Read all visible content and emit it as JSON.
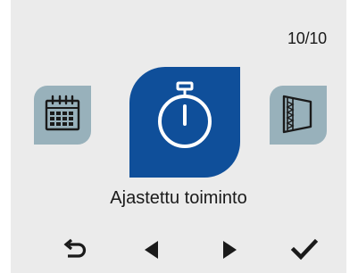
{
  "header": {
    "page_counter": "10/10"
  },
  "carousel": {
    "items": [
      {
        "icon": "calendar-icon",
        "selected": false
      },
      {
        "icon": "stopwatch-icon",
        "selected": true
      },
      {
        "icon": "filter-icon",
        "selected": false
      }
    ],
    "selected_label": "Ajastettu toiminto"
  },
  "nav": {
    "buttons": [
      {
        "icon": "back-arrow-icon"
      },
      {
        "icon": "triangle-left-icon"
      },
      {
        "icon": "triangle-right-icon"
      },
      {
        "icon": "checkmark-icon"
      }
    ]
  },
  "colors": {
    "background": "#ebebeb",
    "selected_tile": "#0f4f9a",
    "inactive_tile": "#98b1bb",
    "icon_dark": "#1a1a1a"
  }
}
